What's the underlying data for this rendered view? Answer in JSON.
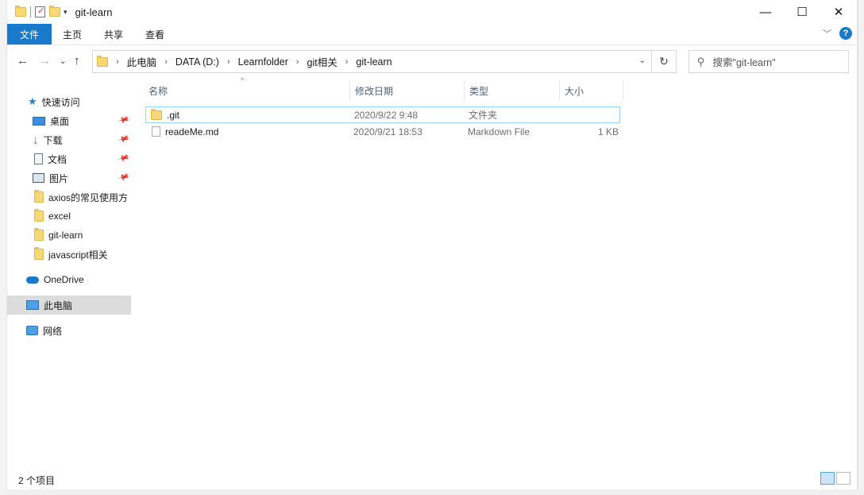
{
  "window": {
    "title": "git-learn"
  },
  "window_controls": {
    "minimize": "—",
    "maximize": "☐",
    "close": "✕"
  },
  "ribbon": {
    "tabs": [
      "文件",
      "主页",
      "共享",
      "查看"
    ],
    "help": "?"
  },
  "address": {
    "crumbs": [
      "此电脑",
      "DATA (D:)",
      "Learnfolder",
      "git相关",
      "git-learn"
    ],
    "sep": "›"
  },
  "search": {
    "placeholder": "搜索\"git-learn\""
  },
  "nav_pane": {
    "quick_access": "快速访问",
    "pinned": [
      "桌面",
      "下载",
      "文档",
      "图片"
    ],
    "folders": [
      "axios的常见使用方",
      "excel",
      "git-learn",
      "javascript相关"
    ],
    "onedrive": "OneDrive",
    "this_pc": "此电脑",
    "network": "网络"
  },
  "columns": {
    "name": "名称",
    "date": "修改日期",
    "type": "类型",
    "size": "大小"
  },
  "files": [
    {
      "name": ".git",
      "date": "2020/9/22 9:48",
      "type": "文件夹",
      "size": ""
    },
    {
      "name": "readeMe.md",
      "date": "2020/9/21 18:53",
      "type": "Markdown File",
      "size": "1 KB"
    }
  ],
  "status": {
    "count": "2 个项目"
  },
  "colors": {
    "accent": "#1979ca",
    "selection_border": "#99d1ff",
    "header_text": "#4c607a"
  }
}
